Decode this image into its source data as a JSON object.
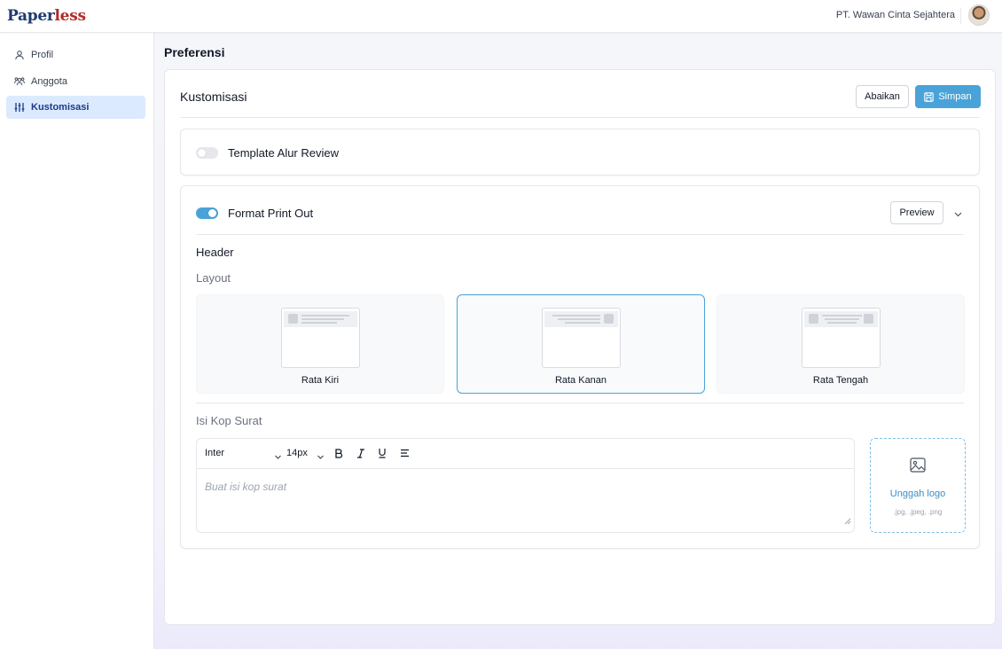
{
  "brand": {
    "part1": "Paper",
    "part2": "less"
  },
  "header": {
    "company": "PT. Wawan Cinta Sejahtera"
  },
  "sidebar": {
    "items": [
      {
        "label": "Profil",
        "icon": "user-icon"
      },
      {
        "label": "Anggota",
        "icon": "users-icon"
      },
      {
        "label": "Kustomisasi",
        "icon": "sliders-icon",
        "active": true
      }
    ]
  },
  "page": {
    "title": "Preferensi"
  },
  "panel": {
    "title": "Kustomisasi",
    "cancel_label": "Abaikan",
    "save_label": "Simpan"
  },
  "template_review": {
    "label": "Template Alur Review",
    "enabled": false
  },
  "print_format": {
    "label": "Format Print Out",
    "enabled": true,
    "preview_label": "Preview",
    "section_header": "Header",
    "layout_heading": "Layout",
    "layout_options": [
      {
        "label": "Rata Kiri",
        "selected": false
      },
      {
        "label": "Rata Kanan",
        "selected": true
      },
      {
        "label": "Rata Tengah",
        "selected": false
      }
    ],
    "kop_heading": "Isi Kop Surat",
    "editor": {
      "font": "Inter",
      "size": "14px",
      "placeholder": "Buat isi kop surat"
    },
    "upload": {
      "label": "Unggah logo",
      "hint": ".jpg, .jpeg, .png"
    }
  },
  "colors": {
    "accent": "#4aa3d8",
    "active_nav_bg": "#dbeafe",
    "brand_blue": "#1e3a6e",
    "brand_red": "#b12a2a"
  }
}
